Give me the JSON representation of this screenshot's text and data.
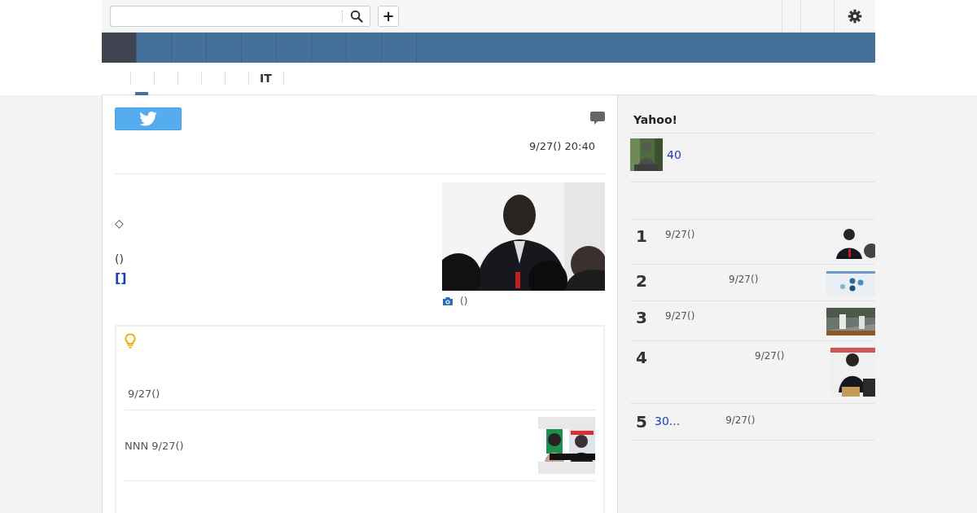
{
  "header": {
    "add_button": "+"
  },
  "nav_tabs": [
    {
      "selected": true
    },
    {
      "selected": false
    },
    {
      "selected": false
    },
    {
      "selected": false
    },
    {
      "selected": false
    },
    {
      "selected": false
    },
    {
      "selected": false
    },
    {
      "selected": false
    },
    {
      "selected": false
    }
  ],
  "sub_tabs": [
    {
      "selected": true
    },
    {
      "selected": false
    },
    {
      "selected": false
    },
    {
      "selected": false
    },
    {
      "selected": false
    },
    {
      "label": "IT",
      "selected": false
    },
    {
      "selected": false
    }
  ],
  "article": {
    "timestamp": "9/27() 20:40",
    "lines": [
      {
        "kind": "text",
        "text": "◇"
      },
      {
        "kind": "text",
        "text": "()"
      },
      {
        "kind": "link",
        "text": "[]"
      }
    ],
    "photo": {
      "kind": "picture",
      "caption": "()"
    }
  },
  "related": {
    "items": [
      {
        "text": "9/27()",
        "thumbnail": false
      },
      {
        "text": "NNN 9/27()",
        "thumbnail": true
      }
    ]
  },
  "sidebar": {
    "title": "Yahoo!",
    "feature": {
      "link": "40"
    },
    "ranking": [
      {
        "rank": "1",
        "date": "9/27()"
      },
      {
        "rank": "2",
        "date": "9/27()"
      },
      {
        "rank": "3",
        "date": "9/27()"
      },
      {
        "rank": "4",
        "date": "9/27()"
      },
      {
        "rank": "5",
        "link": "30...",
        "date": "9/27()"
      }
    ]
  }
}
